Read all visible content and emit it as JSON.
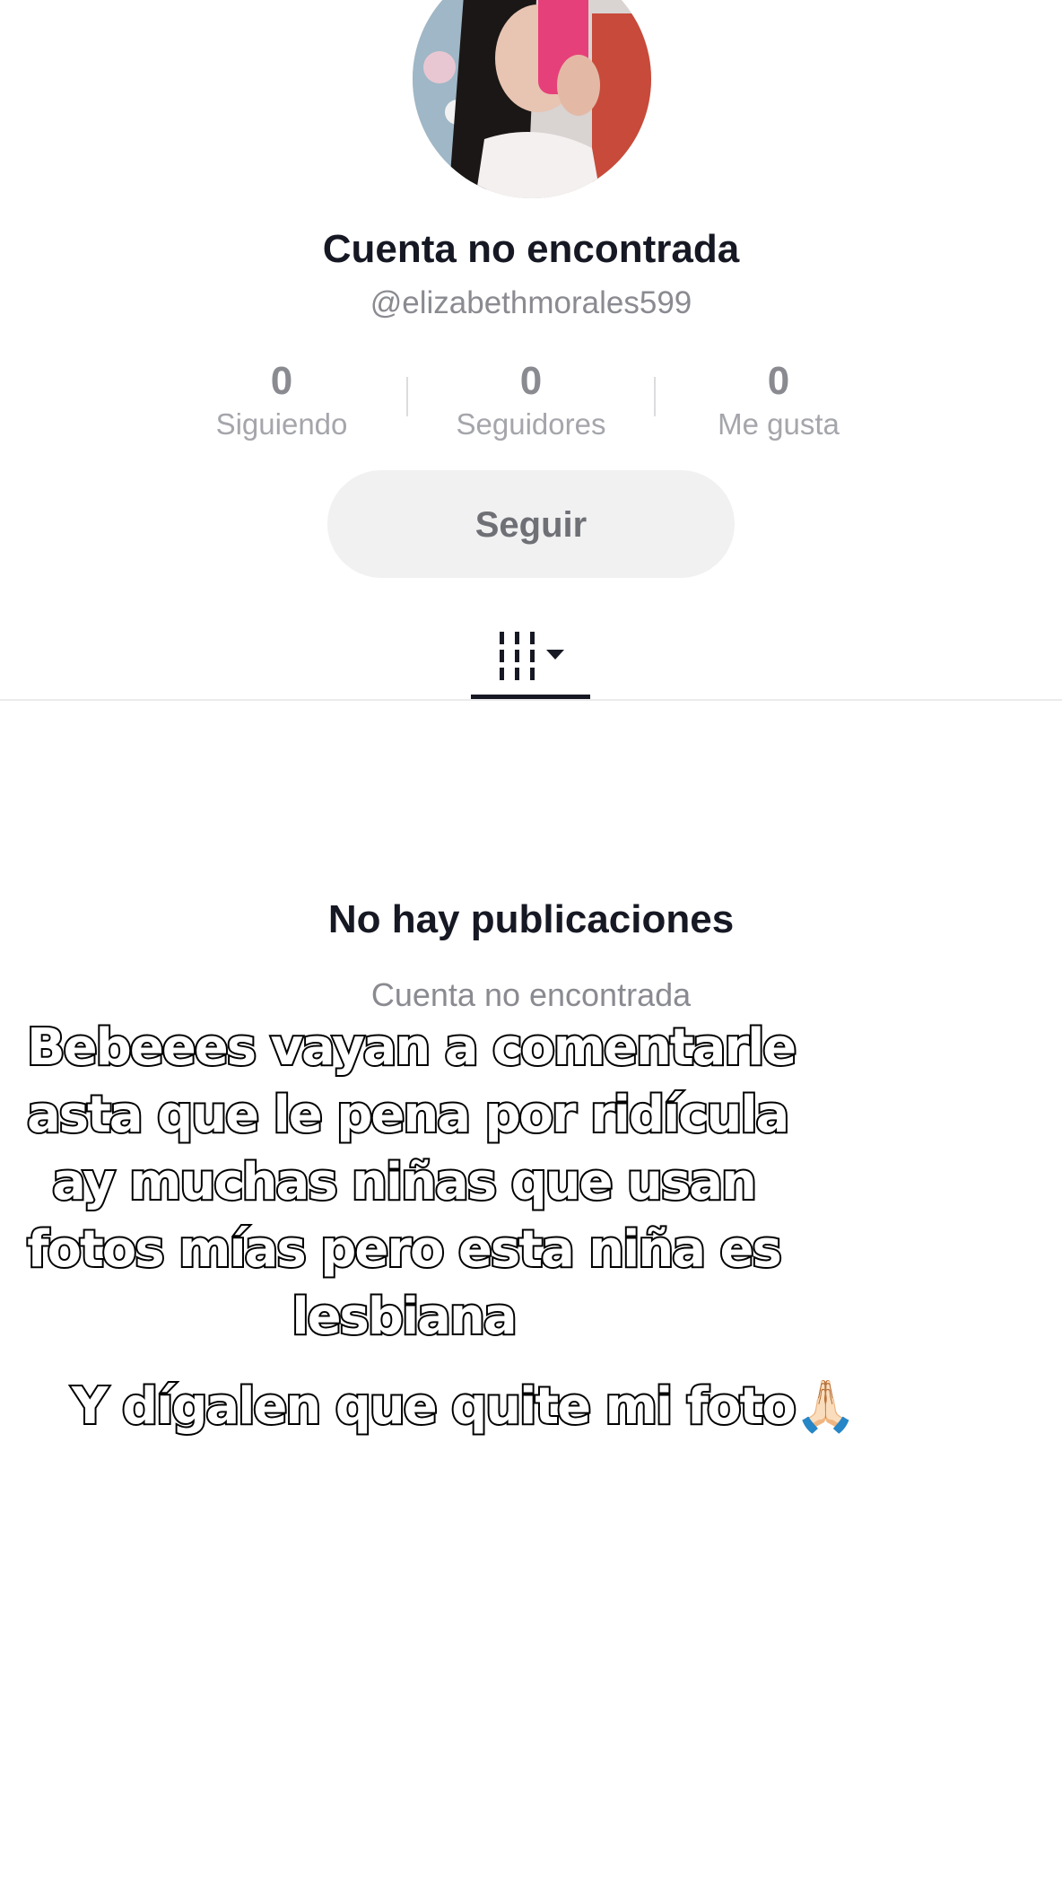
{
  "profile": {
    "name": "Cuenta no encontrada",
    "handle": "@elizabethmorales599"
  },
  "stats": [
    {
      "value": "0",
      "label": "Siguiendo"
    },
    {
      "value": "0",
      "label": "Seguidores"
    },
    {
      "value": "0",
      "label": "Me gusta"
    }
  ],
  "follow_label": "Seguir",
  "tabs": {
    "active_icon": "videos-grid-icon"
  },
  "empty_state": {
    "title": "No hay publicaciones",
    "subtitle": "Cuenta no encontrada"
  },
  "overlay": {
    "lines": [
      "Bebeees vayan a comentarle",
      "asta que le pena por ridícula",
      "ay muchas niñas que usan",
      "fotos mías pero esta niña es",
      "lesbiana"
    ],
    "caption": "Y dígalen que quite mi foto",
    "caption_emoji": "🙏🏻"
  }
}
